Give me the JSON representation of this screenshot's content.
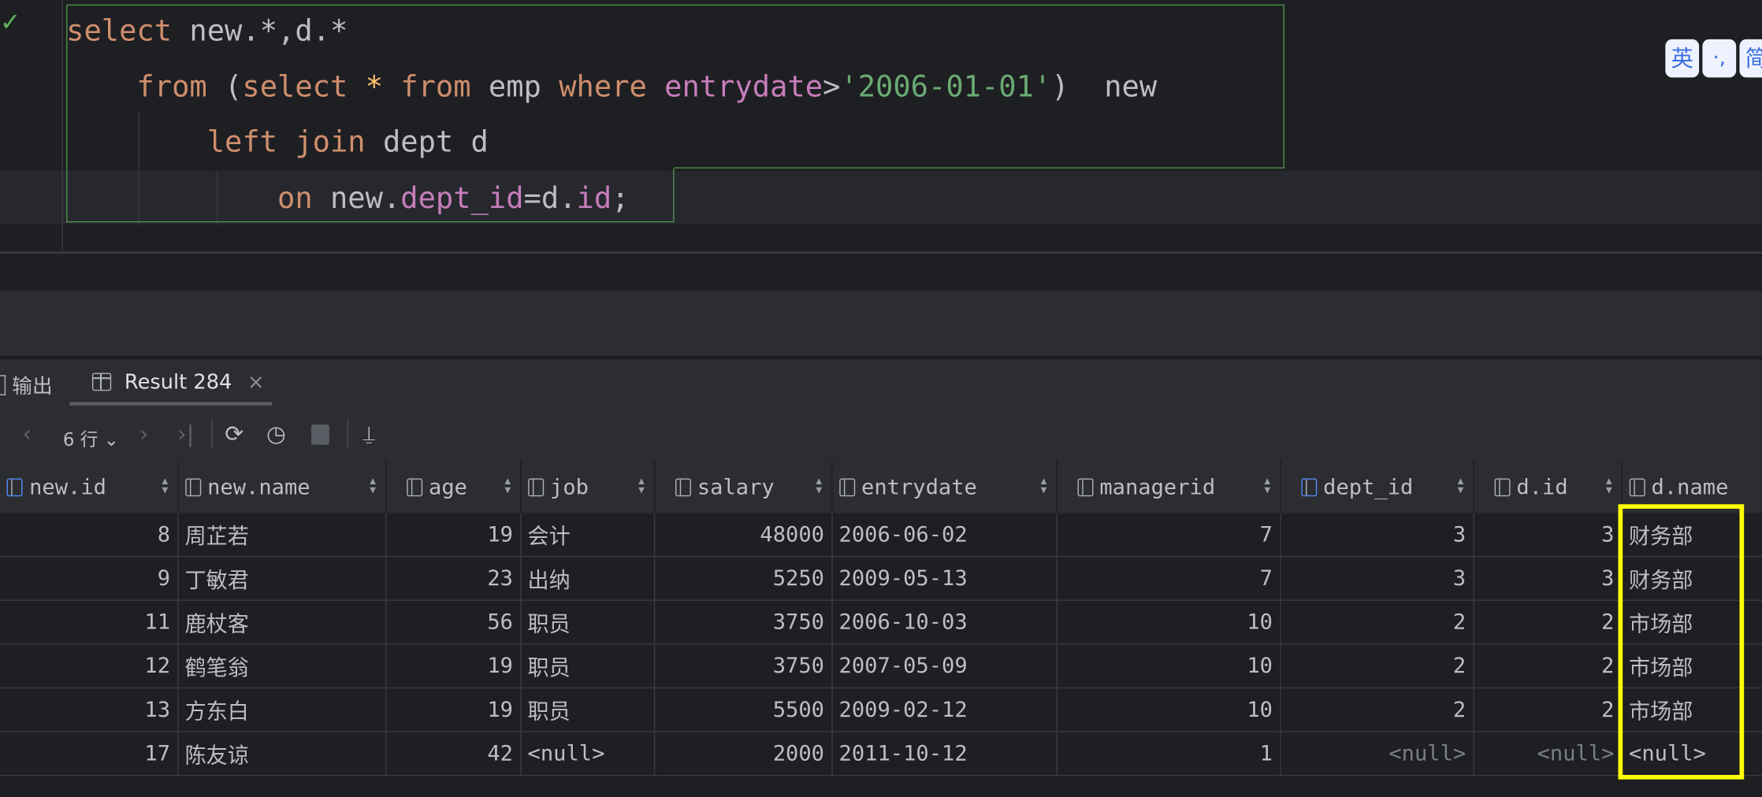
{
  "editor": {
    "lines": [
      [
        {
          "t": "select",
          "c": "kw"
        },
        {
          "t": " new.*,d.*",
          "c": "tx"
        }
      ],
      [
        {
          "t": "    from ",
          "c": "kw"
        },
        {
          "t": "(",
          "c": "tx"
        },
        {
          "t": "select ",
          "c": "kw"
        },
        {
          "t": "* ",
          "c": "yl"
        },
        {
          "t": "from ",
          "c": "kw"
        },
        {
          "t": "emp ",
          "c": "tx"
        },
        {
          "t": "where ",
          "c": "kw"
        },
        {
          "t": "entrydate",
          "c": "pk"
        },
        {
          "t": ">",
          "c": "tx"
        },
        {
          "t": "'2006-01-01'",
          "c": "st"
        },
        {
          "t": ")  new",
          "c": "tx"
        }
      ],
      [
        {
          "t": "        left join ",
          "c": "kw"
        },
        {
          "t": "dept d",
          "c": "tx"
        }
      ],
      [
        {
          "t": "            on ",
          "c": "kw"
        },
        {
          "t": "new.",
          "c": "tx"
        },
        {
          "t": "dept_id",
          "c": "pk"
        },
        {
          "t": "=d.",
          "c": "tx"
        },
        {
          "t": "id",
          "c": "pk"
        },
        {
          "t": ";",
          "c": "tx"
        }
      ]
    ]
  },
  "ime": [
    "英",
    "·,",
    "简"
  ],
  "tabs": [
    {
      "label": "输出",
      "icon": "output-icon"
    },
    {
      "label": "Result 284",
      "icon": "table-icon",
      "active": true
    }
  ],
  "toolbar": {
    "rows_label": "6 行"
  },
  "table": {
    "columns": [
      {
        "name": "new.id",
        "icon": "primary-key-icon"
      },
      {
        "name": "new.name",
        "icon": "index-column-icon"
      },
      {
        "name": "age",
        "icon": "column-icon"
      },
      {
        "name": "job",
        "icon": "column-icon"
      },
      {
        "name": "salary",
        "icon": "column-icon"
      },
      {
        "name": "entrydate",
        "icon": "column-icon"
      },
      {
        "name": "managerid",
        "icon": "column-icon"
      },
      {
        "name": "dept_id",
        "icon": "foreign-key-icon"
      },
      {
        "name": "d.id",
        "icon": "column-icon"
      },
      {
        "name": "d.name",
        "icon": "column-icon"
      }
    ],
    "rows": [
      [
        "8",
        "周芷若",
        "19",
        "会计",
        "48000",
        "2006-06-02",
        "7",
        "3",
        "3",
        "财务部"
      ],
      [
        "9",
        "丁敏君",
        "23",
        "出纳",
        "5250",
        "2009-05-13",
        "7",
        "3",
        "3",
        "财务部"
      ],
      [
        "11",
        "鹿杖客",
        "56",
        "职员",
        "3750",
        "2006-10-03",
        "10",
        "2",
        "2",
        "市场部"
      ],
      [
        "12",
        "鹤笔翁",
        "19",
        "职员",
        "3750",
        "2007-05-09",
        "10",
        "2",
        "2",
        "市场部"
      ],
      [
        "13",
        "方东白",
        "19",
        "职员",
        "5500",
        "2009-02-12",
        "10",
        "2",
        "2",
        "市场部"
      ],
      [
        "17",
        "陈友谅",
        "42",
        "<null>",
        "2000",
        "2011-10-12",
        "1",
        "<null>",
        "<null>",
        "<null>"
      ]
    ],
    "numeric": [
      true,
      false,
      true,
      false,
      true,
      false,
      true,
      true,
      true,
      false
    ]
  },
  "colors": {
    "highlight_box": "#ffff00",
    "selection_border": "#4e8f4e"
  }
}
